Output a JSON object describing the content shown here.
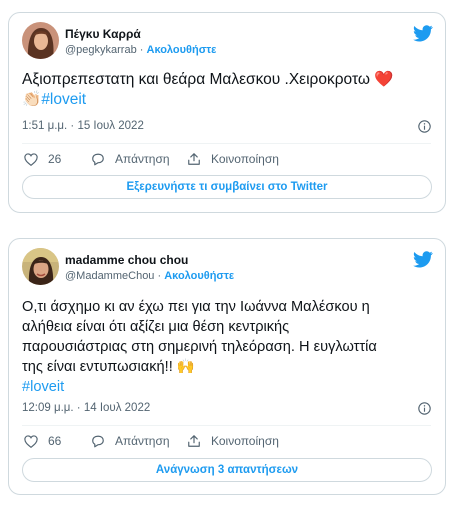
{
  "tweets": [
    {
      "name": "Πέγκυ Καρρά",
      "handle": "@pegkykarrab",
      "separator": "·",
      "follow_label": "Ακολουθήστε",
      "text": "Αξιοπρεπεστατη και θεάρα Μαλεσκου .Χειροκροτω ❤️",
      "emoji_line": "👏🏻",
      "hashtag": "#loveit",
      "timestamp": "1:51 μ.μ. · 15 Ιουλ 2022",
      "likes": "26",
      "reply_label": "Απάντηση",
      "share_label": "Κοινοποίηση",
      "bottom_button": "Εξερευνήστε τι συμβαίνει στο Twitter"
    },
    {
      "name": "madamme chou chou",
      "handle": "@MadammeChou",
      "separator": "·",
      "follow_label": "Ακολουθήστε",
      "text_lines": [
        "Ο,τι άσχημο κι αν έχω πει για  την Ιωάννα Μαλέσκου η",
        "αλήθεια είναι ότι αξίζει μια θέση κεντρικής",
        "παρουσιάστριας στη σημερινή τηλεόραση. Η ευγλωττία",
        "της είναι εντυπωσιακή!! 🙌"
      ],
      "hashtag": "#loveit",
      "timestamp": "12:09 μ.μ. · 14 Ιουλ 2022",
      "likes": "66",
      "reply_label": "Απάντηση",
      "share_label": "Κοινοποίηση",
      "bottom_button": "Ανάγνωση 3 απαντήσεων"
    }
  ],
  "colors": {
    "accent": "#1d9bf0",
    "text": "#0f1419",
    "secondary": "#536471",
    "border": "#cfd9de",
    "heart": "#f91880"
  },
  "icons": [
    "avatar",
    "twitter-bird-icon",
    "info-icon",
    "heart-icon",
    "reply-bubble-icon",
    "share-icon"
  ]
}
